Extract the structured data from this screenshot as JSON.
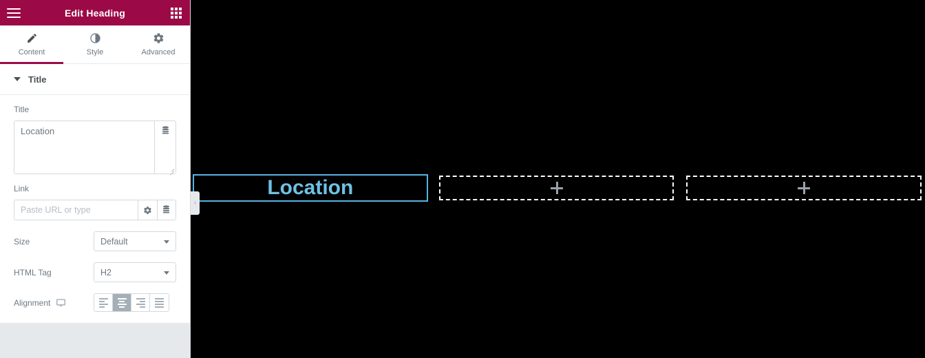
{
  "panel": {
    "header": {
      "title": "Edit Heading",
      "menu_icon": "hamburger-icon",
      "apps_icon": "grid-apps-icon"
    },
    "tabs": [
      {
        "label": "Content",
        "icon": "pencil-icon",
        "active": true
      },
      {
        "label": "Style",
        "icon": "contrast-circle-icon",
        "active": false
      },
      {
        "label": "Advanced",
        "icon": "gear-icon",
        "active": false
      }
    ],
    "section": {
      "title": "Title",
      "collapse_icon": "caret-down-icon"
    },
    "fields": {
      "title": {
        "label": "Title",
        "value": "Location",
        "dynamic_tag_icon": "database-stack-icon"
      },
      "link": {
        "label": "Link",
        "value": "",
        "placeholder": "Paste URL or type",
        "options_icon": "gear-icon",
        "dynamic_tag_icon": "database-stack-icon"
      },
      "size": {
        "label": "Size",
        "value": "Default",
        "caret_icon": "caret-down-icon"
      },
      "html_tag": {
        "label": "HTML Tag",
        "value": "H2",
        "caret_icon": "caret-down-icon"
      },
      "alignment": {
        "label": "Alignment",
        "device_icon": "desktop-monitor-icon",
        "options": [
          {
            "name": "align-left",
            "active": false
          },
          {
            "name": "align-center",
            "active": true
          },
          {
            "name": "align-right",
            "active": false
          },
          {
            "name": "align-justify",
            "active": false
          }
        ]
      }
    },
    "collapse_tab": {
      "icon": "chevron-left-icon",
      "glyph": "‹"
    }
  },
  "canvas": {
    "columns": [
      {
        "type": "heading",
        "text": "Location",
        "selected": true
      },
      {
        "type": "empty",
        "add_icon": "plus-icon"
      },
      {
        "type": "empty",
        "add_icon": "plus-icon"
      }
    ]
  },
  "colors": {
    "brand": "#9b0a46",
    "panel_bg": "#e6e9ec",
    "heading_text": "#6ec1e4",
    "selection_border": "#59b3e6",
    "canvas_bg": "#000000"
  }
}
